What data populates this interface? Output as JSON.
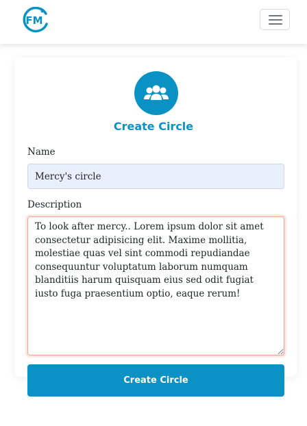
{
  "navbar": {
    "logo_text": "FM",
    "menu_icon": "hamburger-menu-icon"
  },
  "form": {
    "icon": "users-group-icon",
    "title": "Create Circle",
    "name_label": "Name",
    "name_value": "Mercy's circle",
    "description_label": "Description",
    "description_value": "To look after mercy.. Lorem ipsum dolor sit amet consectetur adipisicing elit. Maxime mollitia, molestiae quas vel sint commodi repudiandae consequuntur voluptatum laborum numquam blanditiis harum quisquam eius sed odit fugiat iusto fuga praesentium optio, eaque rerum!",
    "submit_label": "Create Circle"
  },
  "colors": {
    "brand": "#0b92c4",
    "input_fill": "#e8f0fe",
    "focus_border": "#f2a38f"
  }
}
